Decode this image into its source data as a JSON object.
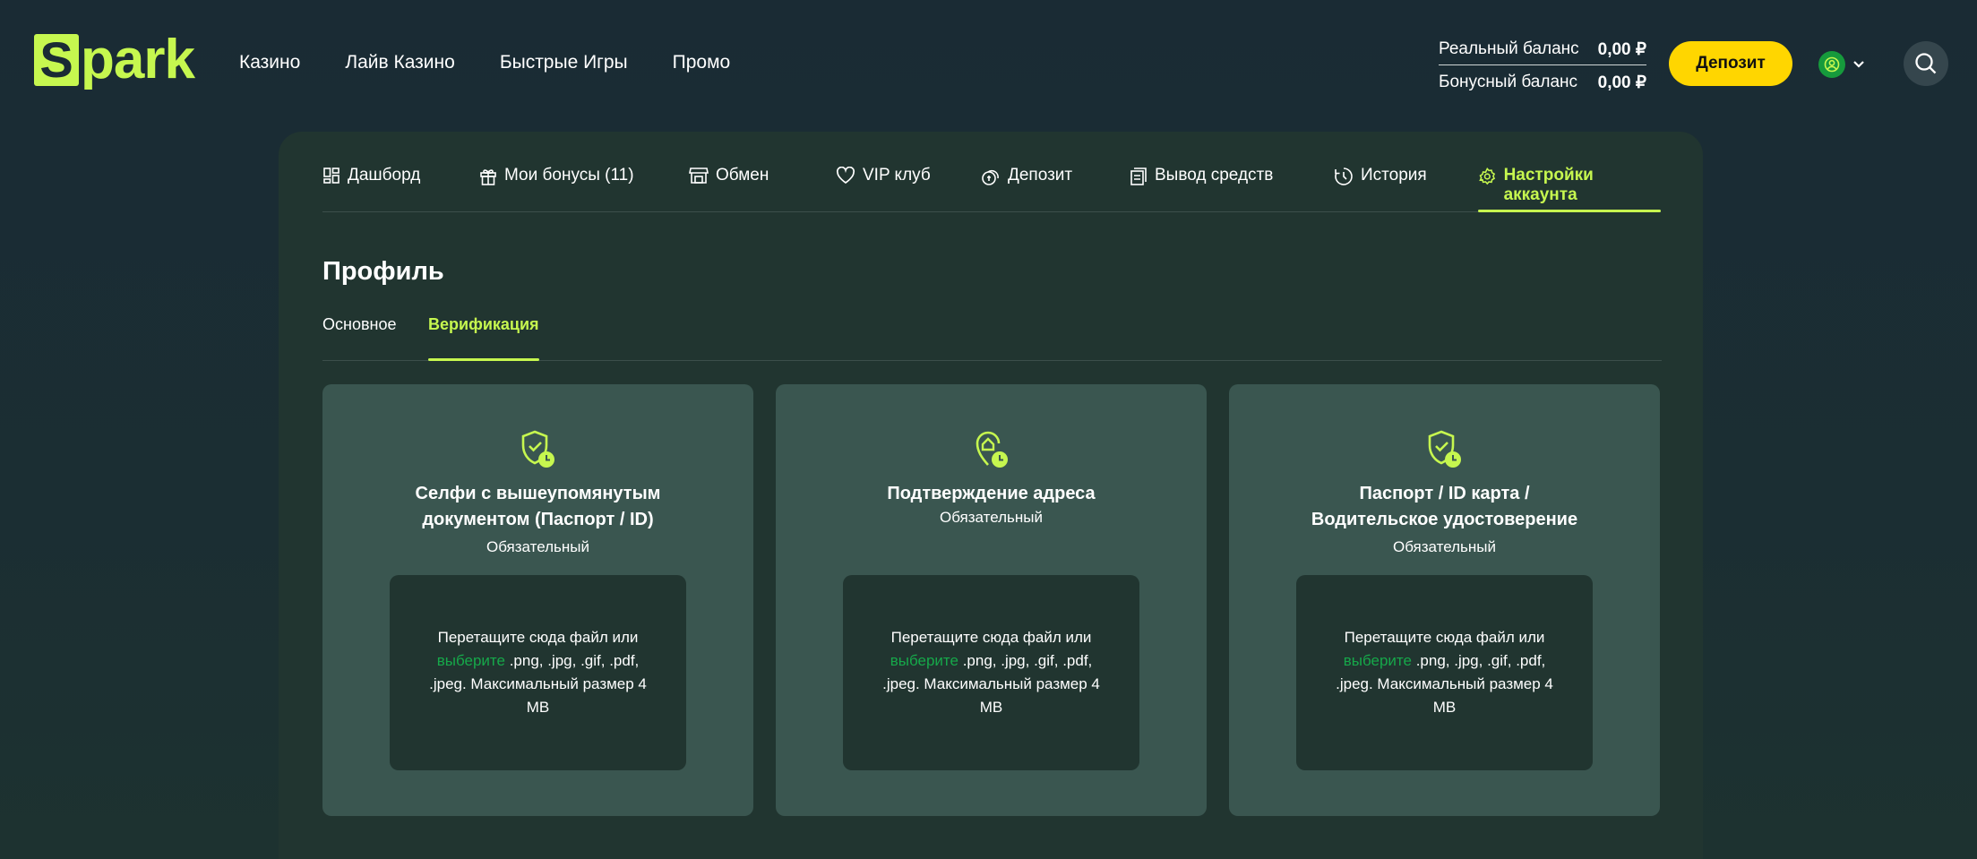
{
  "header": {
    "logo_letter": "S",
    "logo_text": "park",
    "nav": [
      "Казино",
      "Лайв Казино",
      "Быстрые Игры",
      "Промо"
    ],
    "balance": {
      "real_label": "Реальный баланс",
      "real_value": "0,00 ₽",
      "bonus_label": "Бонусный баланс",
      "bonus_value": "0,00 ₽"
    },
    "deposit_label": "Депозит"
  },
  "tabs": [
    {
      "label": "Дашборд",
      "icon": "dashboard-icon"
    },
    {
      "label": "Мои бонусы (11)",
      "icon": "gift-icon"
    },
    {
      "label": "Обмен",
      "icon": "shop-icon"
    },
    {
      "label": "VIP клуб",
      "icon": "heart-icon"
    },
    {
      "label": "Депозит",
      "icon": "coins-icon"
    },
    {
      "label": "Вывод средств",
      "icon": "withdraw-icon"
    },
    {
      "label": "История",
      "icon": "history-icon"
    },
    {
      "label": "Настройки аккаунта",
      "icon": "settings-icon",
      "active": true
    }
  ],
  "profile": {
    "title": "Профиль",
    "subtabs": [
      {
        "label": "Основное"
      },
      {
        "label": "Верификация",
        "active": true
      }
    ]
  },
  "cards": [
    {
      "title_line1": "Селфи с вышеупомянутым",
      "title_line2": "документом (Паспорт / ID)",
      "required": "Обязательный",
      "icon": "shield-check-clock-icon"
    },
    {
      "title_line1": "Подтверждение адреса",
      "title_line2": "",
      "required": "Обязательный",
      "icon": "location-home-clock-icon"
    },
    {
      "title_line1": "Паспорт / ID карта /",
      "title_line2": "Водительское удостоверение",
      "required": "Обязательный",
      "icon": "shield-check-clock-icon"
    }
  ],
  "dropzone": {
    "line1": "Перетащите сюда файл или",
    "pick": "выберите",
    "rest": " .png, .jpg, .gif, .pdf, .jpeg. Максимальный размер 4 MB"
  },
  "colors": {
    "accent": "#c6f74f",
    "deposit_button": "#ffd600",
    "card_bg": "#3a5650",
    "panel_bg": "#213530",
    "link_green": "#16a84a"
  }
}
